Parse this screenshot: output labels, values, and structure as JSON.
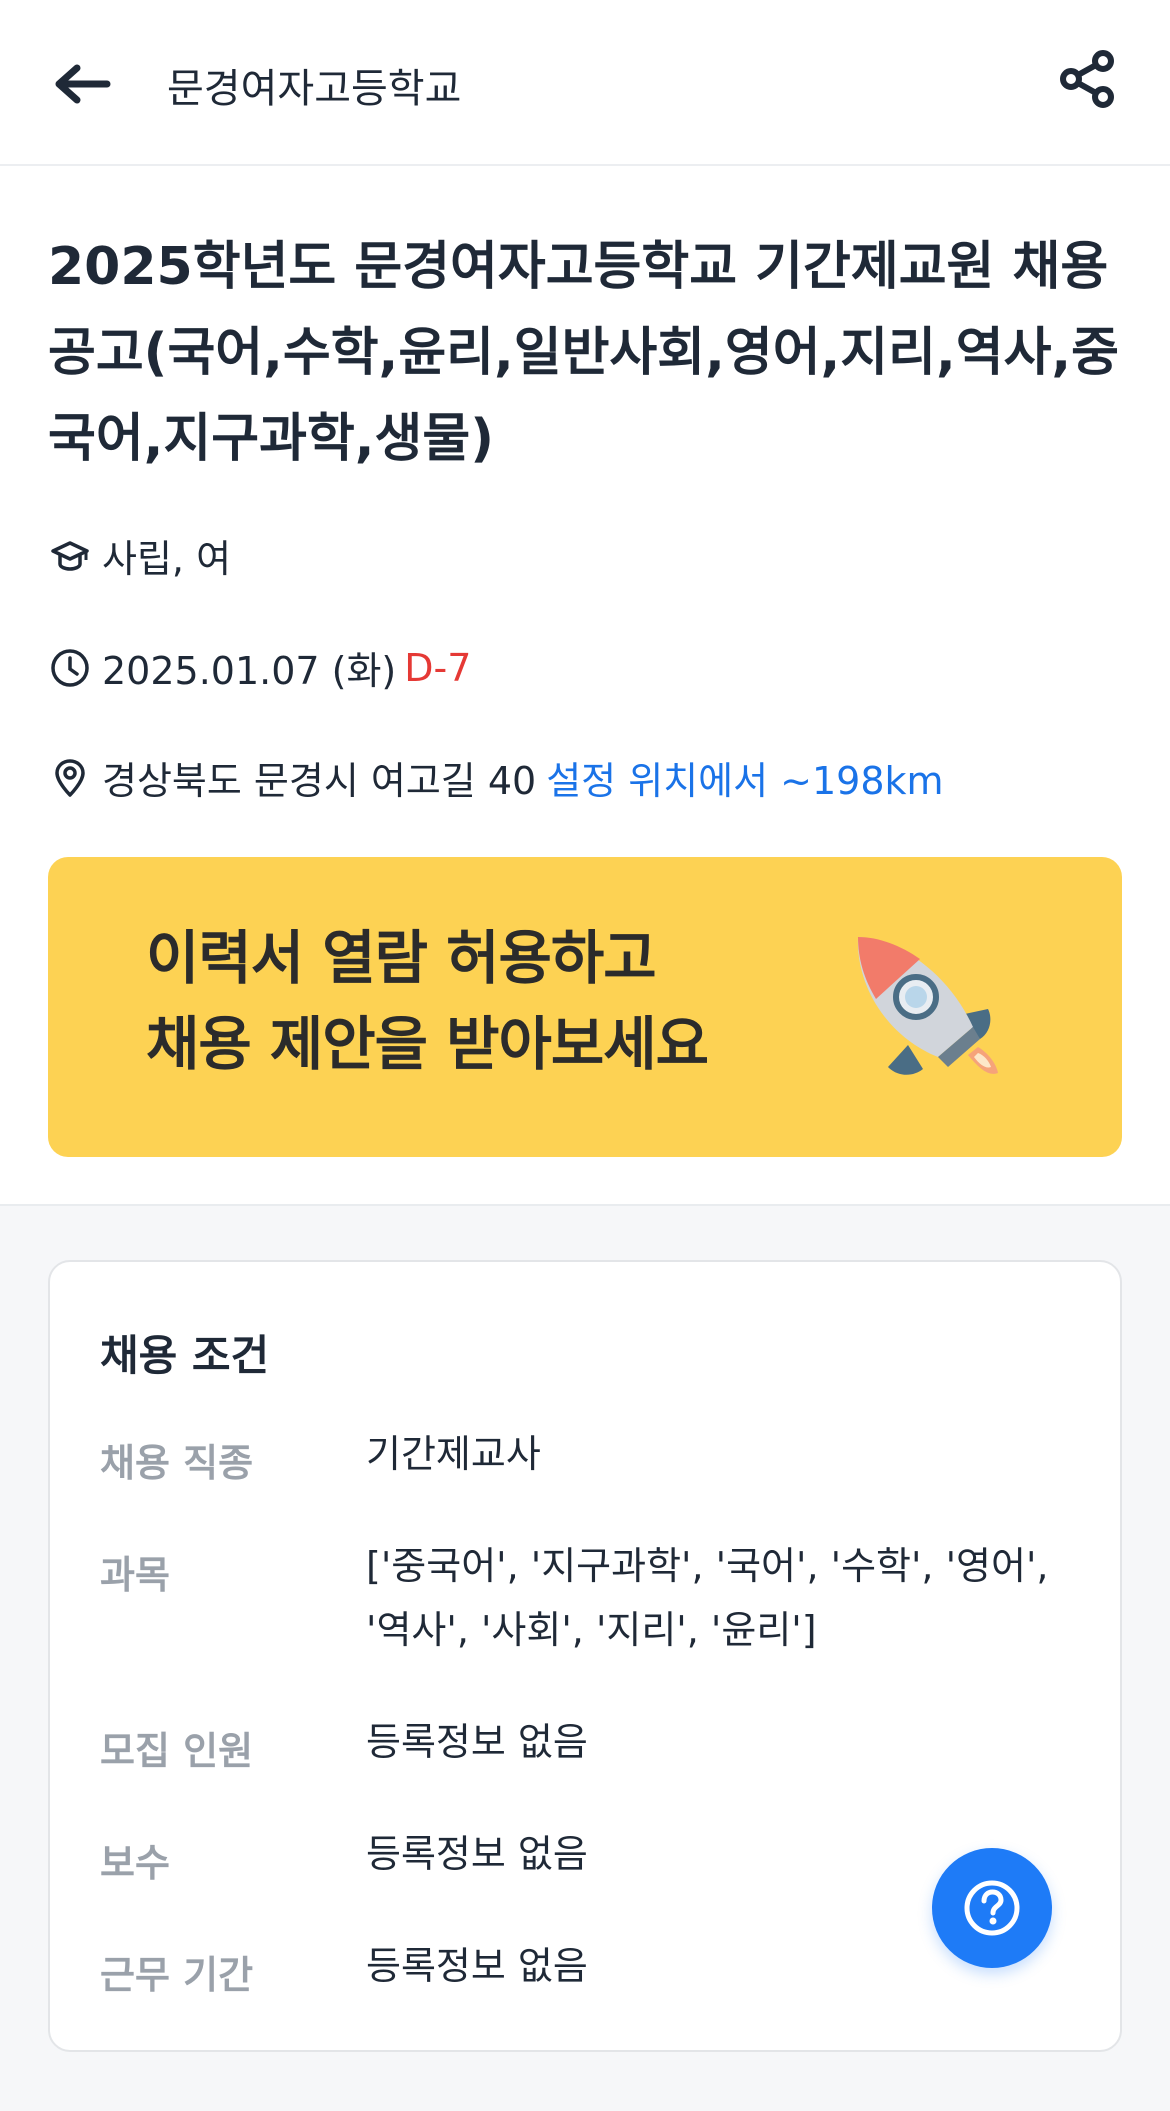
{
  "header": {
    "title": "문경여자고등학교"
  },
  "post": {
    "title": "2025학년도 문경여자고등학교 기간제교원 채용 공고(국어,수학,윤리,일반사회,영어,지리,역사,중국어,지구과학,생물)",
    "school_type": "사립, 여",
    "date": "2025.01.07 (화)",
    "dday": "D-7",
    "address": "경상북도 문경시 여고길 40",
    "distance": "설정 위치에서 ~198km"
  },
  "banner": {
    "line1": "이력서 열람 허용하고",
    "line2": "채용 제안을 받아보세요"
  },
  "conditions": {
    "title": "채용 조건",
    "rows": [
      {
        "label": "채용 직종",
        "value": "기간제교사"
      },
      {
        "label": "과목",
        "value": "['중국어', '지구과학', '국어', '수학', '영어', '역사', '사회', '지리', '윤리']"
      },
      {
        "label": "모집 인원",
        "value": "등록정보 없음"
      },
      {
        "label": "보수",
        "value": "등록정보 없음"
      },
      {
        "label": "근무 기간",
        "value": "등록정보 없음"
      }
    ]
  },
  "icons": {
    "back": "arrow-left-icon",
    "share": "share-icon",
    "school": "graduation-cap-icon",
    "date": "clock-icon",
    "location": "map-pin-icon",
    "banner": "rocket-icon",
    "help": "question-icon"
  },
  "colors": {
    "dday": "#e53935",
    "link": "#1a73e8",
    "banner_bg": "#fdd253",
    "fab": "#1e7bf7",
    "label": "#9aa1aa"
  }
}
